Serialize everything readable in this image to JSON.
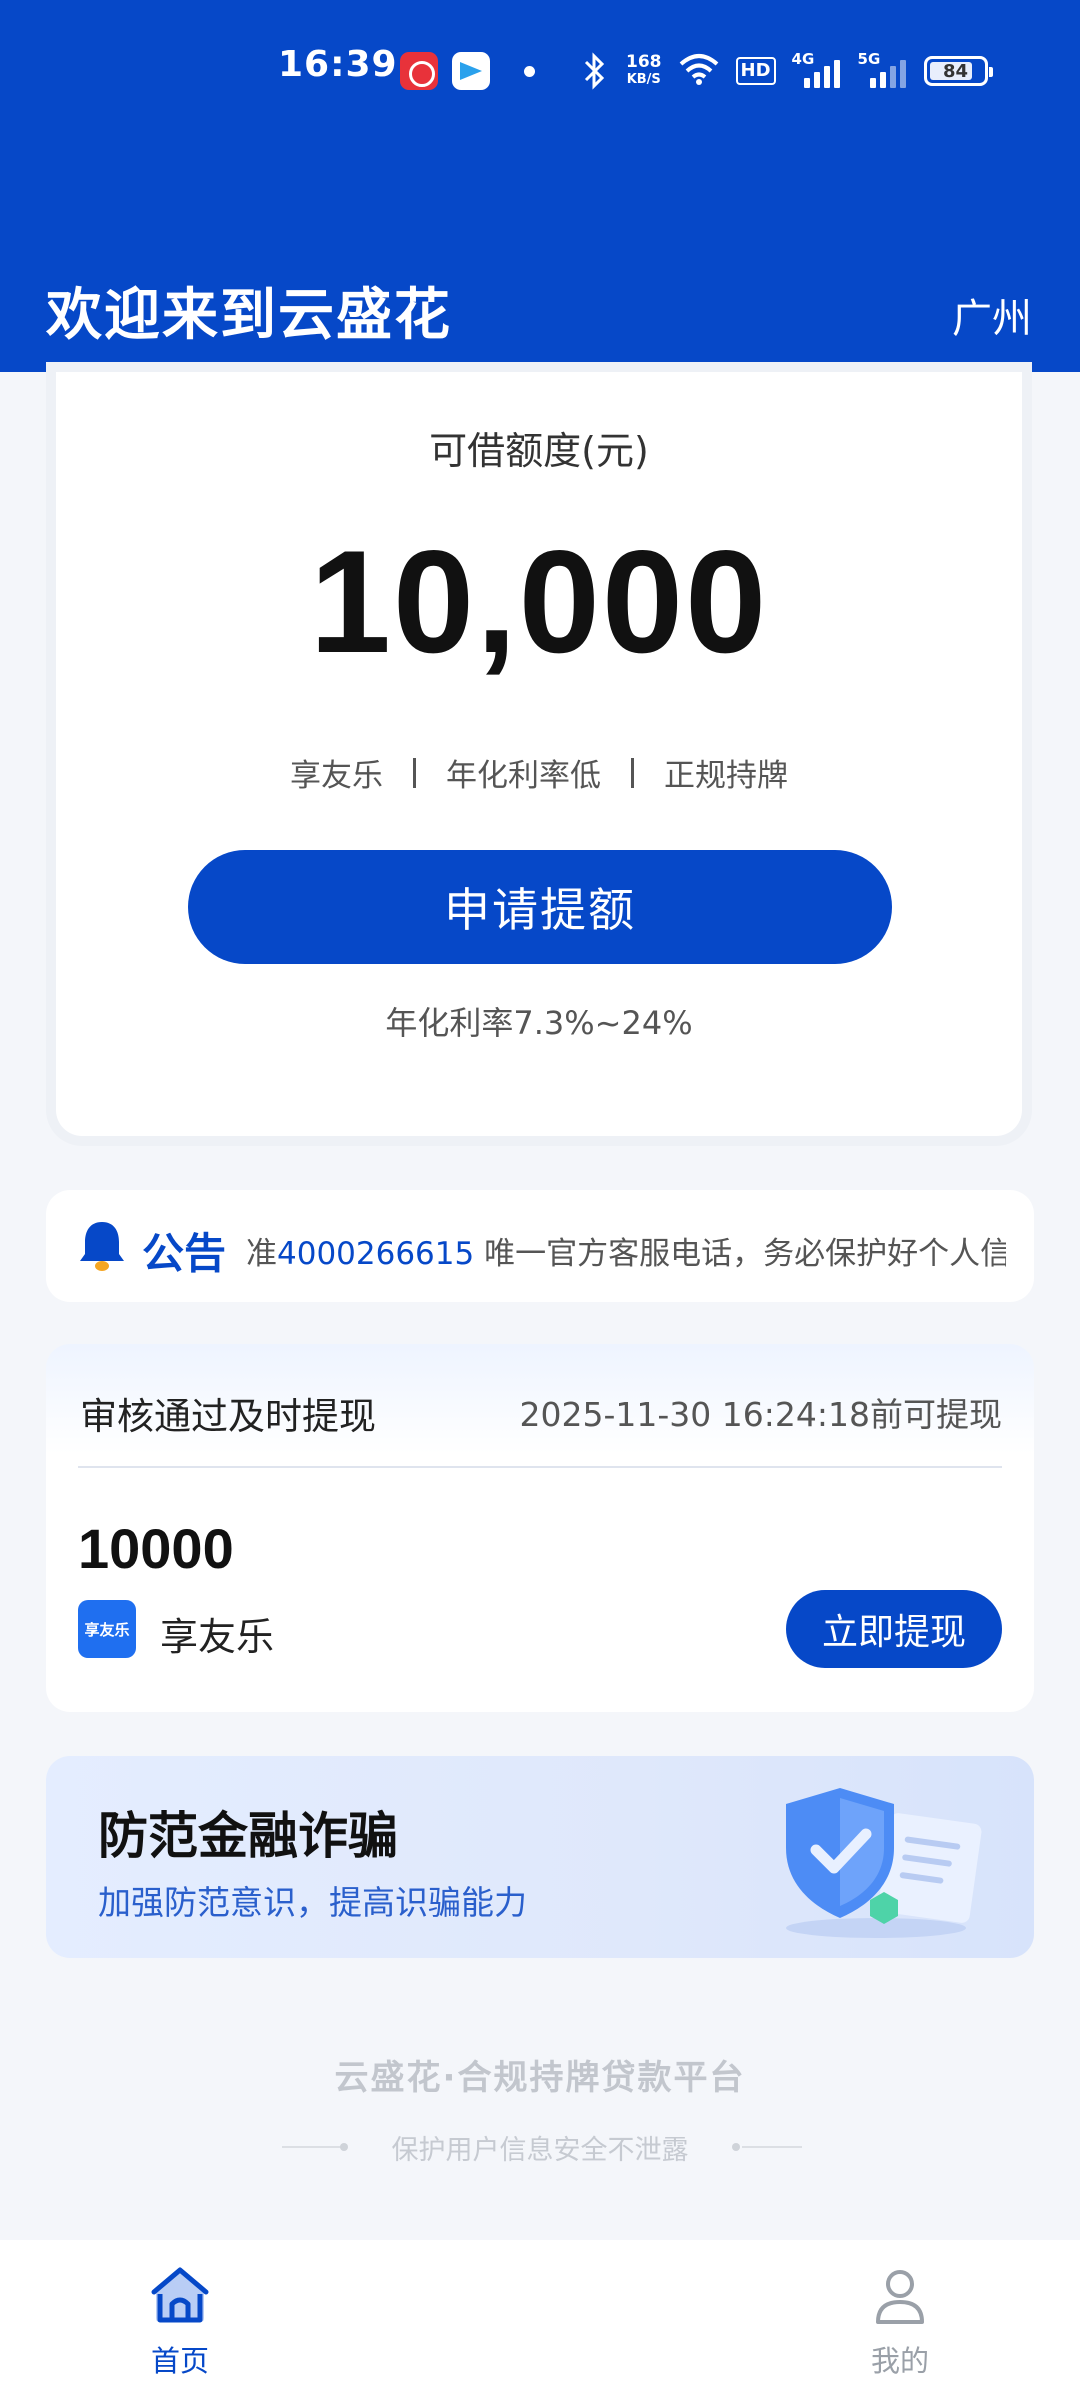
{
  "status_bar": {
    "time": "16:39",
    "net_speed": "168",
    "net_speed_unit": "KB/S",
    "hd_label": "HD",
    "sim1_label": "4G",
    "sim2_label": "5G",
    "battery": "84",
    "battery_level": 0.84
  },
  "header": {
    "title": "欢迎来到云盛花",
    "city": "广州"
  },
  "limit_card": {
    "label": "可借额度(元)",
    "amount": "10,000",
    "tags": [
      "享友乐",
      "年化利率低",
      "正规持牌"
    ],
    "apply_button": "申请提额",
    "rate_note": "年化利率7.3%~24%"
  },
  "notice": {
    "title": "公告",
    "text_prefix": "准",
    "phone": "4000266615",
    "text_suffix": " 唯一官方客服电话，务必保护好个人信息"
  },
  "withdraw": {
    "title": "审核通过及时提现",
    "deadline": "2025-11-30 16:24:18前可提现",
    "amount": "10000",
    "logo_text": "享友乐",
    "brand": "享友乐",
    "button": "立即提现"
  },
  "fraud_banner": {
    "title": "防范金融诈骗",
    "subtitle": "加强防范意识，提高识骗能力"
  },
  "footer": {
    "main": "云盛花·合规持牌贷款平台",
    "sub": "保护用户信息安全不泄露"
  },
  "bottom_nav": {
    "items": [
      {
        "label": "首页",
        "icon": "home-icon",
        "active": true
      },
      {
        "label": "我的",
        "icon": "user-icon",
        "active": false
      }
    ]
  },
  "colors": {
    "brand": "#0648c8",
    "background": "#f4f6fa"
  }
}
